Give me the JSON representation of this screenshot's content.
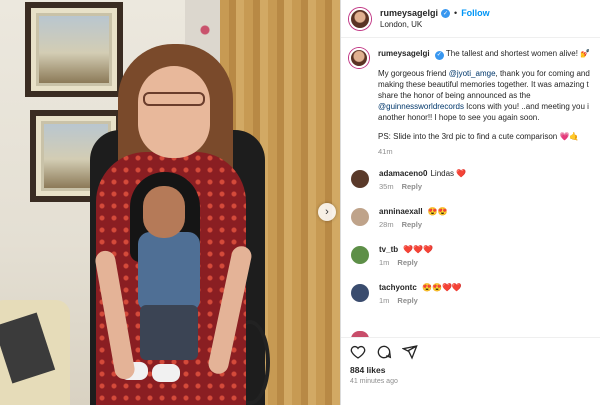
{
  "post": {
    "account": {
      "username": "rumeysagelgi",
      "verified": true,
      "separator": "•",
      "follow_label": "Follow",
      "location": "London, UK"
    },
    "caption": {
      "lead": "The tallest and shortest women alive!",
      "lead_emoji": "💅",
      "lines": [
        "My gorgeous friend ",
        "making these beautiful memories together. It was amazing t",
        "share the honor of being announced as the",
        "Icons with you! ..and meeting you i",
        "another honor!! I hope to see you again soon."
      ],
      "mention_1": "@jyoti_amge",
      "line1_tail": ", thank you for coming and",
      "mention_2": "@guinnessworldrecords",
      "ps": "PS: Slide into the 3rd pic to find a cute comparison",
      "ps_emoji": "💗🤙",
      "timestamp": "41m"
    },
    "comments": [
      {
        "username": "adamaceno0",
        "text": "Lindas",
        "emoji": "❤️",
        "time": "35m",
        "reply_label": "Reply",
        "avatar_color": "#5a3a2a"
      },
      {
        "username": "anninaexall",
        "text": "",
        "emoji": "😍😍",
        "time": "28m",
        "reply_label": "Reply",
        "avatar_color": "#bfa38a"
      },
      {
        "username": "tv_tb",
        "text": "",
        "emoji": "❤️❤️❤️",
        "time": "1m",
        "reply_label": "Reply",
        "avatar_color": "#5d8f47"
      },
      {
        "username": "tachyontc",
        "text": "",
        "emoji": "😍😍❤️❤️",
        "time": "1m",
        "reply_label": "Reply",
        "avatar_color": "#3a4c6e"
      }
    ],
    "likes": "884 likes",
    "posted_ago": "41 minutes ago",
    "icons": {
      "like": "heart-icon",
      "comment": "comment-icon",
      "share": "share-icon",
      "next": "chevron-right-icon"
    },
    "colors": {
      "link": "#00376b",
      "follow": "#0095f6",
      "verified": "#3897f0",
      "muted": "#8e8e8e"
    }
  }
}
